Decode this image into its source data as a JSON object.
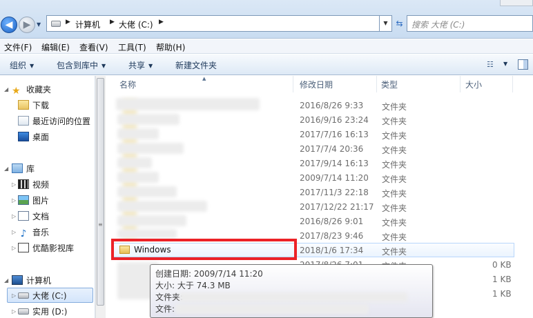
{
  "address": {
    "crumbs": [
      "计算机",
      "大佬 (C:)"
    ],
    "search_placeholder": "搜索 大佬 (C:)"
  },
  "menu": [
    "文件(F)",
    "编辑(E)",
    "查看(V)",
    "工具(T)",
    "帮助(H)"
  ],
  "toolbar": {
    "organize": "组织",
    "include_in_library": "包含到库中",
    "share": "共享",
    "new_folder": "新建文件夹"
  },
  "nav": {
    "favorites": "收藏夹",
    "downloads": "下载",
    "recent": "最近访问的位置",
    "desktop": "桌面",
    "libraries": "库",
    "videos": "视频",
    "pictures": "图片",
    "documents": "文档",
    "music": "音乐",
    "youku": "优酷影视库",
    "computer": "计算机",
    "drive_c": "大佬 (C:)",
    "drive_d": "实用 (D:)"
  },
  "columns": {
    "name": "名称",
    "modified": "修改日期",
    "type": "类型",
    "size": "大小"
  },
  "rows": [
    {
      "date": "2016/8/26 9:33",
      "type": "文件夹",
      "size": ""
    },
    {
      "date": "2016/9/16 23:24",
      "type": "文件夹",
      "size": ""
    },
    {
      "date": "2017/7/16 16:13",
      "type": "文件夹",
      "size": ""
    },
    {
      "date": "2017/7/4 20:36",
      "type": "文件夹",
      "size": ""
    },
    {
      "date": "2017/9/14 16:13",
      "type": "文件夹",
      "size": ""
    },
    {
      "date": "2009/7/14 11:20",
      "type": "文件夹",
      "size": ""
    },
    {
      "date": "2017/11/3 22:18",
      "type": "文件夹",
      "size": ""
    },
    {
      "date": "2017/12/22 21:17",
      "type": "文件夹",
      "size": ""
    },
    {
      "date": "2016/8/26 9:01",
      "type": "文件夹",
      "size": ""
    },
    {
      "date": "2017/8/23 9:46",
      "type": "文件夹",
      "size": ""
    },
    {
      "name": "Windows",
      "date": "2018/1/6 17:34",
      "type": "文件夹",
      "size": ""
    },
    {
      "date": "2017/8/26 7:01",
      "type": "文件夹",
      "size": "0 KB"
    },
    {
      "date": "",
      "type": "",
      "size": "1 KB"
    },
    {
      "date": "",
      "type": "",
      "size": "1 KB"
    }
  ],
  "tooltip": {
    "created": "创建日期: 2009/7/14 11:20",
    "size": "大小: 大于 74.3 MB",
    "folders": "文件夹:",
    "files": "文件:"
  }
}
